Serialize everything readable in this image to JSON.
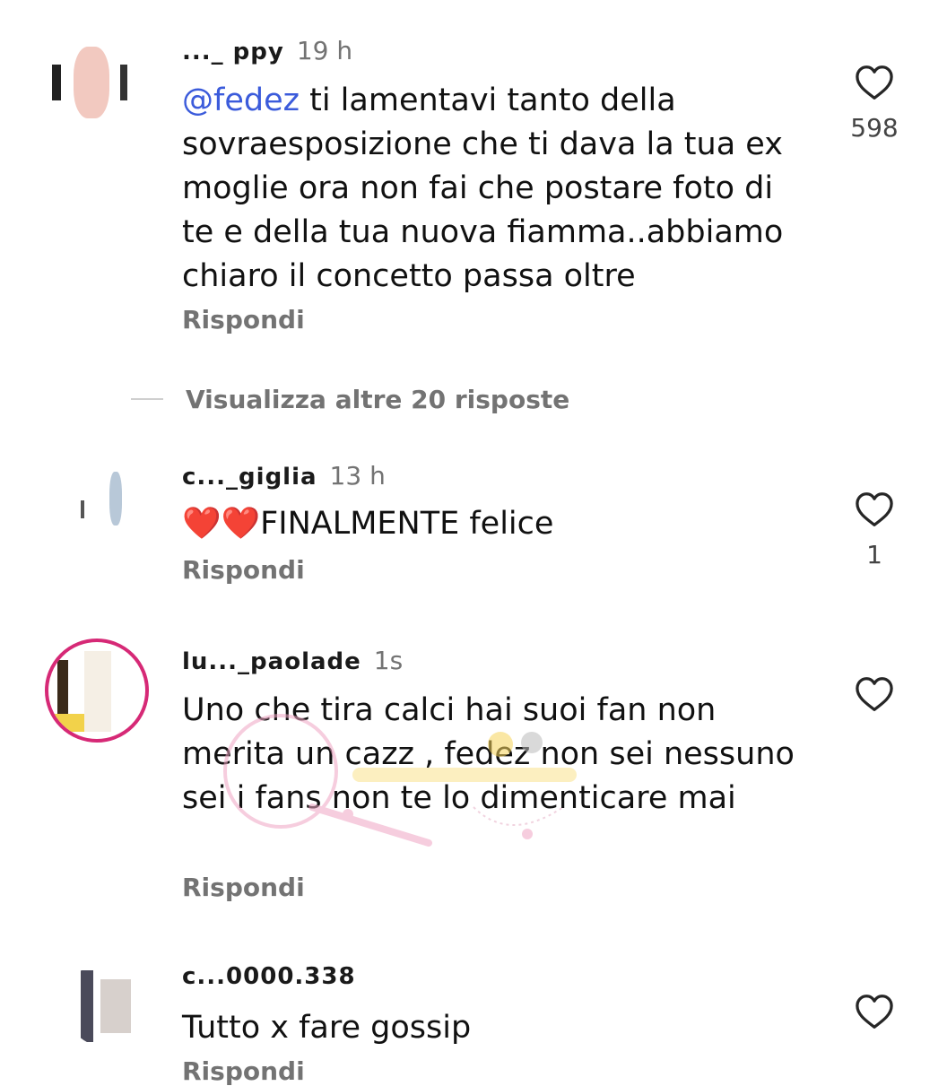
{
  "comments": [
    {
      "username": "..._ ppy",
      "time": "19 h",
      "mention": "@fedez",
      "text": " ti lamentavi tanto della sovraesposizione che ti dava la tua ex moglie ora non fai che postare foto di te e della tua nuova  fiamma..abbiamo chiaro il concetto passa oltre",
      "reply_label": "Rispondi",
      "likes": "598"
    },
    {
      "username": "c..._giglia",
      "time": "13 h",
      "text": "❤️❤️FINALMENTE felice",
      "reply_label": "Rispondi",
      "likes": "1"
    },
    {
      "username": "lu..._paolade",
      "time": "1s",
      "text": "Uno che tira calci hai suoi fan non merita un cazz , fedez non sei nessuno sei i fans non te lo dimenticare mai",
      "reply_label": "Rispondi",
      "likes": ""
    },
    {
      "username": "c...0000.338",
      "time": "",
      "text": "Tutto x fare gossip",
      "reply_label": "Rispondi",
      "likes": ""
    }
  ],
  "view_more": {
    "label": "Visualizza altre 20 risposte"
  },
  "icons": {
    "like": "heart-outline-icon"
  },
  "colors": {
    "mention": "#3b5bdb",
    "secondary_text": "#737373",
    "heart_stroke": "#262626"
  }
}
